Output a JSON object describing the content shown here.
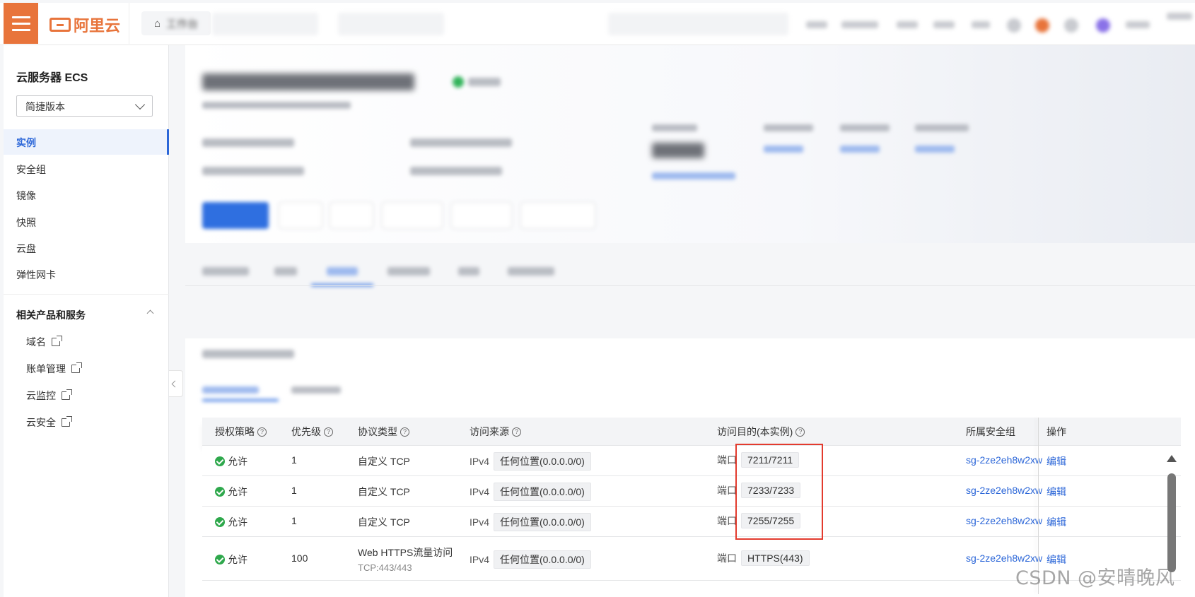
{
  "topbar": {
    "brand": "阿里云",
    "workbench_label": "工作台"
  },
  "sidebar": {
    "title": "云服务器 ECS",
    "version_select": "简捷版本",
    "items": [
      {
        "label": "实例",
        "active": true
      },
      {
        "label": "安全组"
      },
      {
        "label": "镜像"
      },
      {
        "label": "快照"
      },
      {
        "label": "云盘"
      },
      {
        "label": "弹性网卡"
      }
    ],
    "section_title": "相关产品和服务",
    "sub_items": [
      {
        "label": "域名"
      },
      {
        "label": "账单管理"
      },
      {
        "label": "云监控"
      },
      {
        "label": "云安全"
      }
    ]
  },
  "table": {
    "headers": {
      "policy": "授权策略",
      "priority": "优先级",
      "protocol": "协议类型",
      "source": "访问来源",
      "dest": "访问目的(本实例)",
      "group": "所属安全组",
      "ops": "操作"
    },
    "rows": [
      {
        "policy": "允许",
        "priority": "1",
        "protocol": "自定义 TCP",
        "protocol_sub": "",
        "ip": "IPv4",
        "source": "任何位置(0.0.0.0/0)",
        "port_label": "端口",
        "port": "7211/7211",
        "group": "sg-2ze2eh8w2xw",
        "op": "编辑"
      },
      {
        "policy": "允许",
        "priority": "1",
        "protocol": "自定义 TCP",
        "protocol_sub": "",
        "ip": "IPv4",
        "source": "任何位置(0.0.0.0/0)",
        "port_label": "端口",
        "port": "7233/7233",
        "group": "sg-2ze2eh8w2xw",
        "op": "编辑"
      },
      {
        "policy": "允许",
        "priority": "1",
        "protocol": "自定义 TCP",
        "protocol_sub": "",
        "ip": "IPv4",
        "source": "任何位置(0.0.0.0/0)",
        "port_label": "端口",
        "port": "7255/7255",
        "group": "sg-2ze2eh8w2xw",
        "op": "编辑"
      },
      {
        "policy": "允许",
        "priority": "100",
        "protocol": "Web HTTPS流量访问",
        "protocol_sub": "TCP:443/443",
        "ip": "IPv4",
        "source": "任何位置(0.0.0.0/0)",
        "port_label": "端口",
        "port": "HTTPS(443)",
        "group": "sg-2ze2eh8w2xw",
        "op": "编辑"
      }
    ]
  },
  "watermark": "CSDN @安晴晚风",
  "colors": {
    "brand": "#e8743b",
    "accent": "#2b66d8",
    "success": "#2ea84c",
    "highlight": "#e33b2e"
  }
}
